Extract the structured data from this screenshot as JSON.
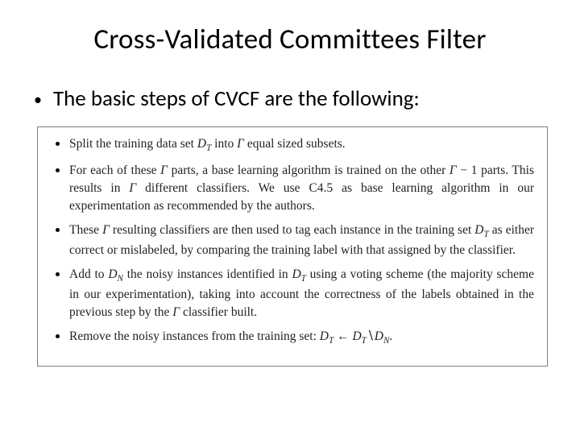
{
  "title": "Cross-Validated Committees Filter",
  "intro": "The basic steps of CVCF are the following:",
  "steps": [
    "Split the training data set D_T into Γ equal sized subsets.",
    "For each of these Γ parts, a base learning algorithm is trained on the other Γ − 1 parts. This results in Γ different classifiers. We use C4.5 as base learning algorithm in our experimentation as recommended by the authors.",
    "These Γ resulting classifiers are then used to tag each instance in the training set D_T as either correct or mislabeled, by comparing the training label with that assigned by the classifier.",
    "Add to D_N the noisy instances identified in D_T using a voting scheme (the majority scheme in our experimentation), taking into account the correctness of the labels obtained in the previous step by the Γ classifier built.",
    "Remove the noisy instances from the training set: D_T ← D_T \\ D_N."
  ],
  "symbols": {
    "training_set": "D_T",
    "noisy_set": "D_N",
    "gamma": "Γ",
    "base_learner": "C4.5"
  }
}
